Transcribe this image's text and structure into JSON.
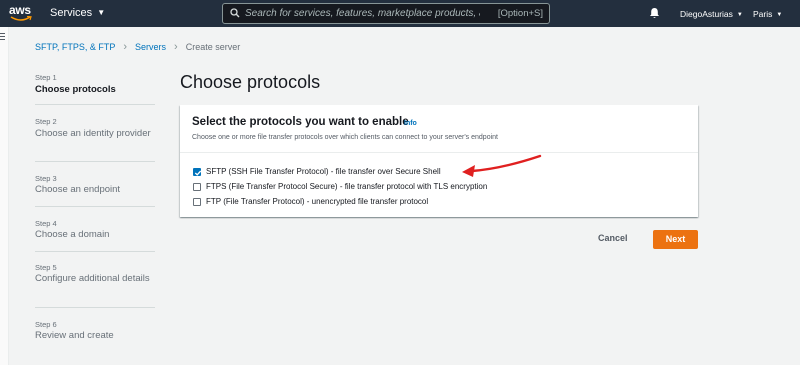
{
  "topnav": {
    "logo_text": "aws",
    "services_label": "Services",
    "search_placeholder": "Search for services, features, marketplace products, and docs",
    "search_shortcut": "[Option+S]",
    "user_name": "DiegoAsturias",
    "region": "Paris"
  },
  "breadcrumb": {
    "items": [
      "SFTP, FTPS, & FTP",
      "Servers",
      "Create server"
    ]
  },
  "steps": [
    {
      "label": "Step 1",
      "title": "Choose protocols",
      "active": true
    },
    {
      "label": "Step 2",
      "title": "Choose an identity provider",
      "active": false
    },
    {
      "label": "Step 3",
      "title": "Choose an endpoint",
      "active": false
    },
    {
      "label": "Step 4",
      "title": "Choose a domain",
      "active": false
    },
    {
      "label": "Step 5",
      "title": "Configure additional details",
      "active": false
    },
    {
      "label": "Step 6",
      "title": "Review and create",
      "active": false
    }
  ],
  "page_title": "Choose protocols",
  "panel": {
    "title": "Select the protocols you want to enable",
    "info_label": "Info",
    "description": "Choose one or more file transfer protocols over which clients can connect to your server's endpoint",
    "options": [
      {
        "label": "SFTP (SSH File Transfer Protocol) - file transfer over Secure Shell",
        "checked": true
      },
      {
        "label": "FTPS (File Transfer Protocol Secure) - file transfer protocol with TLS encryption",
        "checked": false
      },
      {
        "label": "FTP (File Transfer Protocol) - unencrypted file transfer protocol",
        "checked": false
      }
    ]
  },
  "actions": {
    "cancel_label": "Cancel",
    "next_label": "Next"
  },
  "colors": {
    "nav_bg": "#232f3e",
    "link": "#0073bb",
    "primary_button": "#ec7211",
    "annotation_arrow": "#e02020"
  }
}
